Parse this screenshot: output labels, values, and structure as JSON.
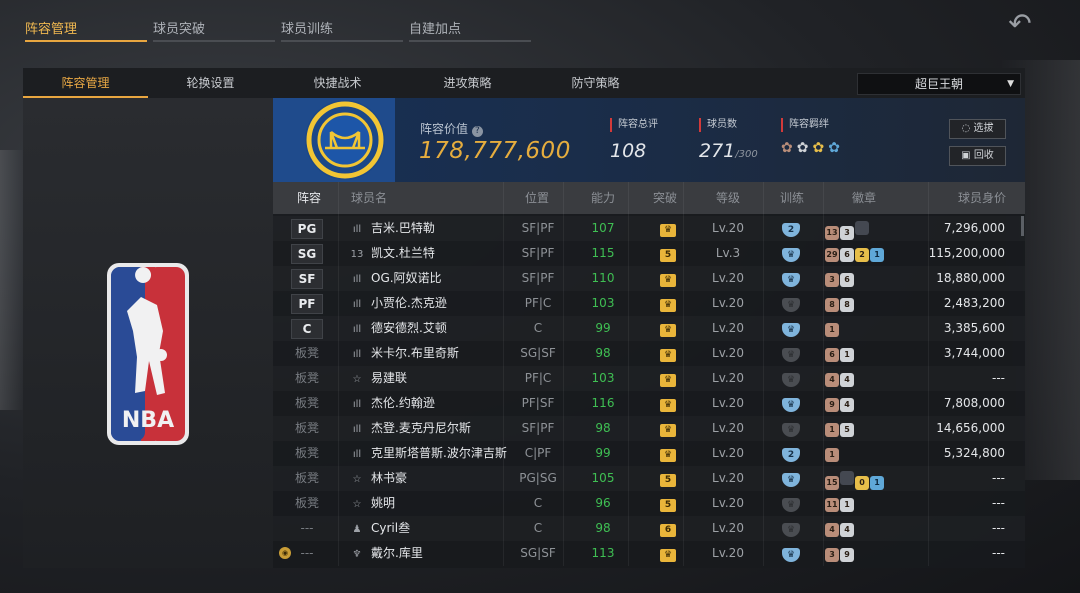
{
  "top_tabs": [
    "阵容管理",
    "球员突破",
    "球员训练",
    "自建加点"
  ],
  "sub_tabs": [
    "阵容管理",
    "轮换设置",
    "快捷战术",
    "进攻策略",
    "防守策略"
  ],
  "dropdown": {
    "selected": "超巨王朝"
  },
  "header": {
    "value_label": "阵容价值",
    "value": "178,777,600",
    "rating_label": "阵容总评",
    "rating": "108",
    "count_label": "球员数",
    "count": "271",
    "count_max": "/300",
    "bond_label": "阵容羁绊",
    "select_btn": "选拔",
    "recycle_btn": "回收"
  },
  "columns": [
    "阵容",
    "球员名",
    "位置",
    "能力",
    "突破",
    "等级",
    "训练",
    "徽章",
    "球员身价"
  ],
  "colors": {
    "accent": "#e8a640",
    "ability": "#3fbf53",
    "value": "#e6ad3e"
  },
  "rows": [
    {
      "slot": "PG",
      "starter": true,
      "icon": "ıll",
      "name": "吉米.巴特勒",
      "pos": "SF|PF",
      "ability": "107",
      "brk": "♛",
      "level": "Lv.20",
      "train": "2",
      "train_on": true,
      "badges": [
        [
          "13",
          "bronze"
        ],
        [
          "3",
          "silver"
        ],
        [
          "",
          "dark"
        ]
      ],
      "salary": "7,296,000"
    },
    {
      "slot": "SG",
      "starter": true,
      "icon": "13",
      "name": "凯文.杜兰特",
      "pos": "SF|PF",
      "ability": "115",
      "brk": "5",
      "level": "Lv.3",
      "train": "♛",
      "train_on": true,
      "badges": [
        [
          "29",
          "bronze"
        ],
        [
          "6",
          "silver"
        ],
        [
          "2",
          "gold"
        ],
        [
          "1",
          "blue"
        ]
      ],
      "salary": "115,200,000"
    },
    {
      "slot": "SF",
      "starter": true,
      "icon": "ıll",
      "name": "OG.阿奴诺比",
      "pos": "SF|PF",
      "ability": "110",
      "brk": "♛",
      "level": "Lv.20",
      "train": "♛",
      "train_on": true,
      "badges": [
        [
          "3",
          "bronze"
        ],
        [
          "6",
          "silver"
        ]
      ],
      "salary": "18,880,000"
    },
    {
      "slot": "PF",
      "starter": true,
      "icon": "ıll",
      "name": "小贾伦.杰克逊",
      "pos": "PF|C",
      "ability": "103",
      "brk": "♛",
      "level": "Lv.20",
      "train": "♛",
      "train_on": false,
      "badges": [
        [
          "8",
          "bronze"
        ],
        [
          "8",
          "silver"
        ]
      ],
      "salary": "2,483,200"
    },
    {
      "slot": "C",
      "starter": true,
      "icon": "ıll",
      "name": "德安德烈.艾顿",
      "pos": "C",
      "ability": "99",
      "brk": "♛",
      "level": "Lv.20",
      "train": "♛",
      "train_on": true,
      "badges": [
        [
          "1",
          "bronze"
        ]
      ],
      "salary": "3,385,600"
    },
    {
      "slot": "板凳",
      "starter": false,
      "icon": "ıll",
      "name": "米卡尔.布里奇斯",
      "pos": "SG|SF",
      "ability": "98",
      "brk": "♛",
      "level": "Lv.20",
      "train": "♛",
      "train_on": false,
      "badges": [
        [
          "6",
          "bronze"
        ],
        [
          "1",
          "silver"
        ]
      ],
      "salary": "3,744,000"
    },
    {
      "slot": "板凳",
      "starter": false,
      "icon": "☆",
      "name": "易建联",
      "pos": "PF|C",
      "ability": "103",
      "brk": "♛",
      "level": "Lv.20",
      "train": "♛",
      "train_on": false,
      "badges": [
        [
          "4",
          "bronze"
        ],
        [
          "4",
          "silver"
        ]
      ],
      "salary": "---"
    },
    {
      "slot": "板凳",
      "starter": false,
      "icon": "ıll",
      "name": "杰伦.约翰逊",
      "pos": "PF|SF",
      "ability": "116",
      "brk": "♛",
      "level": "Lv.20",
      "train": "♛",
      "train_on": true,
      "badges": [
        [
          "9",
          "bronze"
        ],
        [
          "4",
          "silver"
        ]
      ],
      "salary": "7,808,000"
    },
    {
      "slot": "板凳",
      "starter": false,
      "icon": "ıll",
      "name": "杰登.麦克丹尼尔斯",
      "pos": "SF|PF",
      "ability": "98",
      "brk": "♛",
      "level": "Lv.20",
      "train": "♛",
      "train_on": false,
      "badges": [
        [
          "1",
          "bronze"
        ],
        [
          "5",
          "silver"
        ]
      ],
      "salary": "14,656,000"
    },
    {
      "slot": "板凳",
      "starter": false,
      "icon": "ıll",
      "name": "克里斯塔普斯.波尔津吉斯",
      "pos": "C|PF",
      "ability": "99",
      "brk": "♛",
      "level": "Lv.20",
      "train": "2",
      "train_on": true,
      "badges": [
        [
          "1",
          "bronze"
        ]
      ],
      "salary": "5,324,800"
    },
    {
      "slot": "板凳",
      "starter": false,
      "icon": "☆",
      "name": "林书豪",
      "pos": "PG|SG",
      "ability": "105",
      "brk": "5",
      "level": "Lv.20",
      "train": "♛",
      "train_on": true,
      "badges": [
        [
          "15",
          "bronze"
        ],
        [
          "",
          "dark"
        ],
        [
          "0",
          "gold"
        ],
        [
          "1",
          "blue"
        ]
      ],
      "salary": "---"
    },
    {
      "slot": "板凳",
      "starter": false,
      "icon": "☆",
      "name": "姚明",
      "pos": "C",
      "ability": "96",
      "brk": "5",
      "level": "Lv.20",
      "train": "♛",
      "train_on": false,
      "badges": [
        [
          "11",
          "bronze"
        ],
        [
          "1",
          "silver"
        ]
      ],
      "salary": "---"
    },
    {
      "slot": "---",
      "starter": false,
      "icon": "♟",
      "name": "Cyril叁",
      "pos": "C",
      "ability": "98",
      "brk": "6",
      "level": "Lv.20",
      "train": "♛",
      "train_on": false,
      "badges": [
        [
          "4",
          "bronze"
        ],
        [
          "4",
          "silver"
        ]
      ],
      "salary": "---"
    },
    {
      "slot": "---",
      "starter": false,
      "icon": "♆",
      "name": "戴尔.库里",
      "pos": "SG|SF",
      "ability": "113",
      "brk": "♛",
      "level": "Lv.20",
      "train": "♛",
      "train_on": true,
      "badges": [
        [
          "3",
          "bronze"
        ],
        [
          "9",
          "silver"
        ]
      ],
      "salary": "---",
      "crest": true
    }
  ]
}
